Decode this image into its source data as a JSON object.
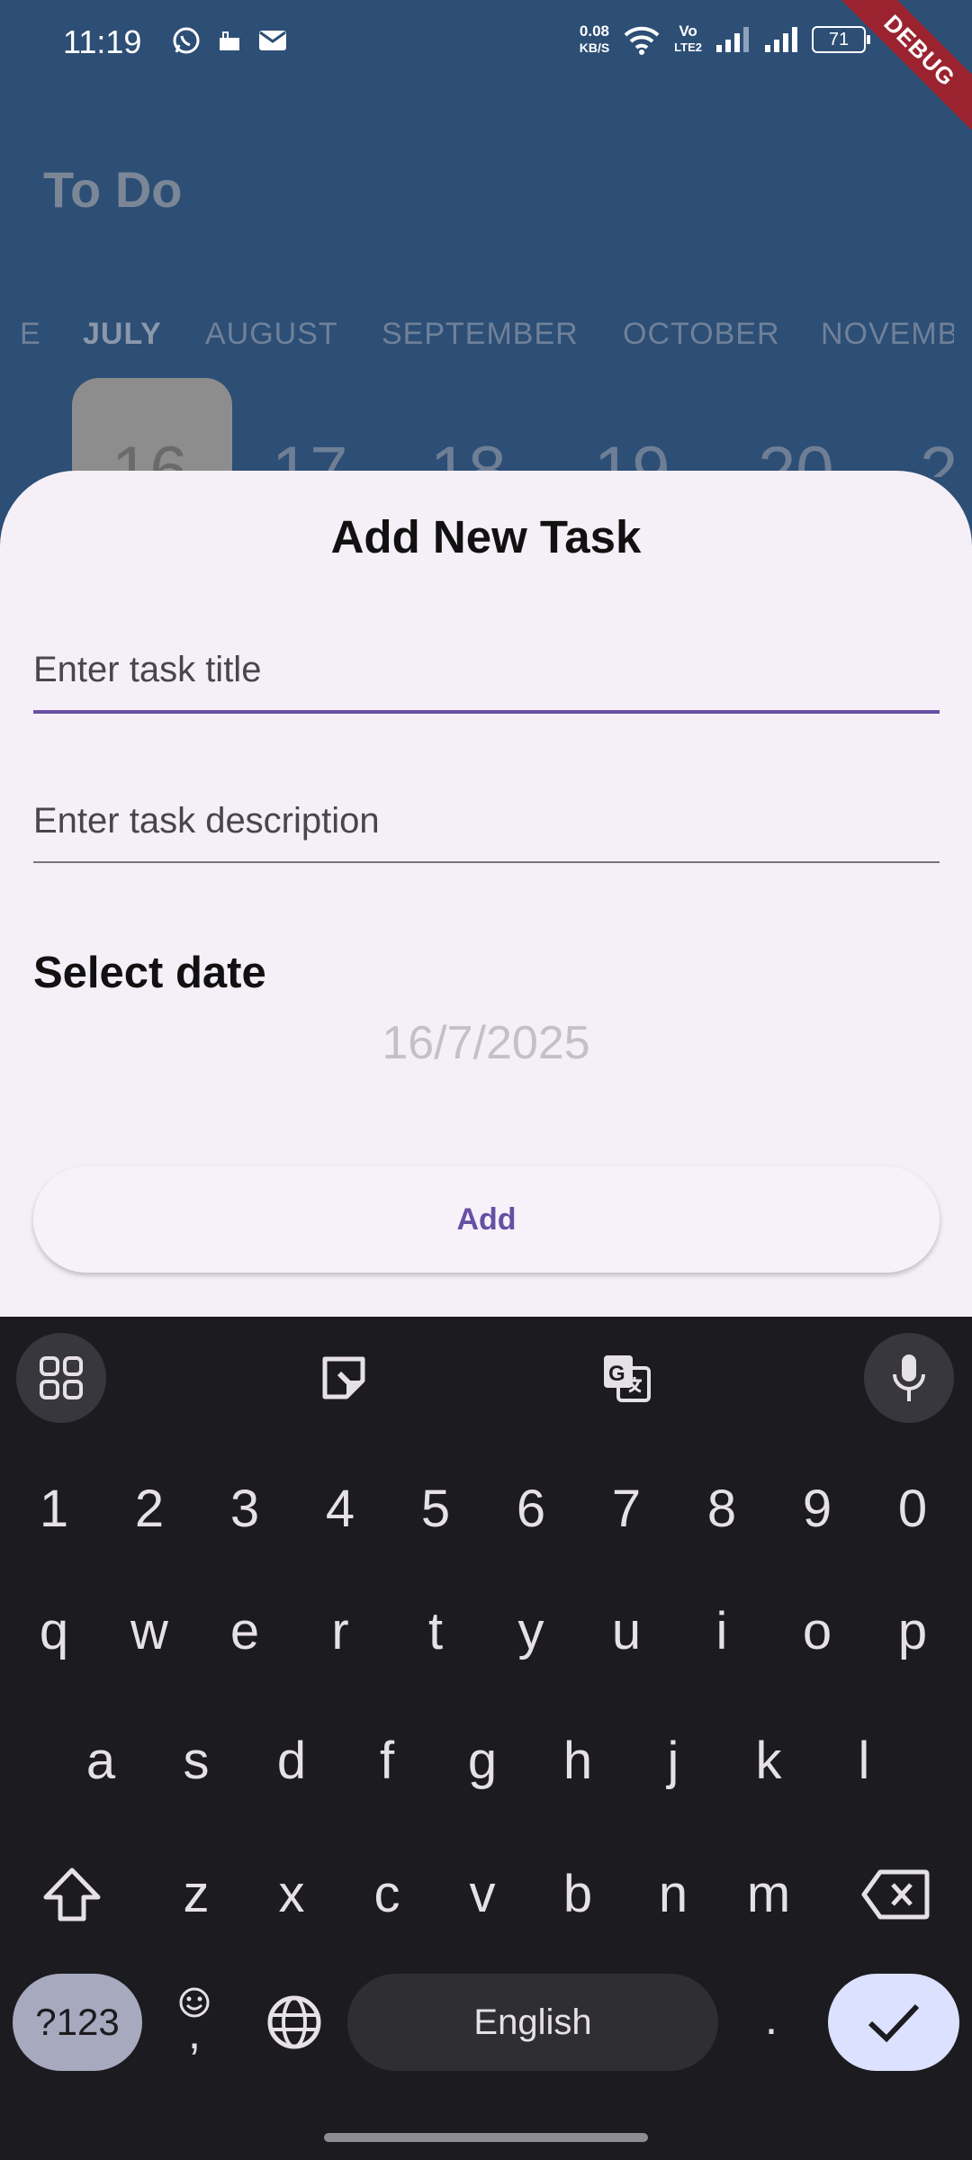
{
  "status_bar": {
    "time": "11:19",
    "net_speed_value": "0.08",
    "net_speed_unit": "KB/S",
    "volte_top": "Vo",
    "volte_bottom": "LTE2",
    "battery": "71"
  },
  "debug_banner": "DEBUG",
  "app": {
    "title": "To Do",
    "months": [
      "E",
      "JULY",
      "AUGUST",
      "SEPTEMBER",
      "OCTOBER",
      "NOVEMB"
    ],
    "days": [
      "16",
      "17",
      "18",
      "19",
      "20",
      "2"
    ]
  },
  "sheet": {
    "title": "Add New Task",
    "title_field": {
      "placeholder": "Enter task title",
      "value": ""
    },
    "description_field": {
      "placeholder": "Enter task description",
      "value": ""
    },
    "select_date_label": "Select date",
    "date_value": "16/7/2025",
    "add_button": "Add"
  },
  "keyboard": {
    "toolbar_icons": [
      "apps-grid-icon",
      "sticker-icon",
      "translate-icon",
      "microphone-icon"
    ],
    "number_row": [
      "1",
      "2",
      "3",
      "4",
      "5",
      "6",
      "7",
      "8",
      "9",
      "0"
    ],
    "row1": [
      "q",
      "w",
      "e",
      "r",
      "t",
      "y",
      "u",
      "i",
      "o",
      "p"
    ],
    "row2": [
      "a",
      "s",
      "d",
      "f",
      "g",
      "h",
      "j",
      "k",
      "l"
    ],
    "row3": [
      "z",
      "x",
      "c",
      "v",
      "b",
      "n",
      "m"
    ],
    "symbols_key": "?123",
    "comma_key": ",",
    "space_key": "English",
    "period_key": "."
  },
  "colors": {
    "app_background": "#2d4e75",
    "sheet_background": "#f5eff7",
    "accent": "#6750a4",
    "keyboard_background": "#1c1b1f",
    "debug_ribbon": "#9b2330"
  }
}
